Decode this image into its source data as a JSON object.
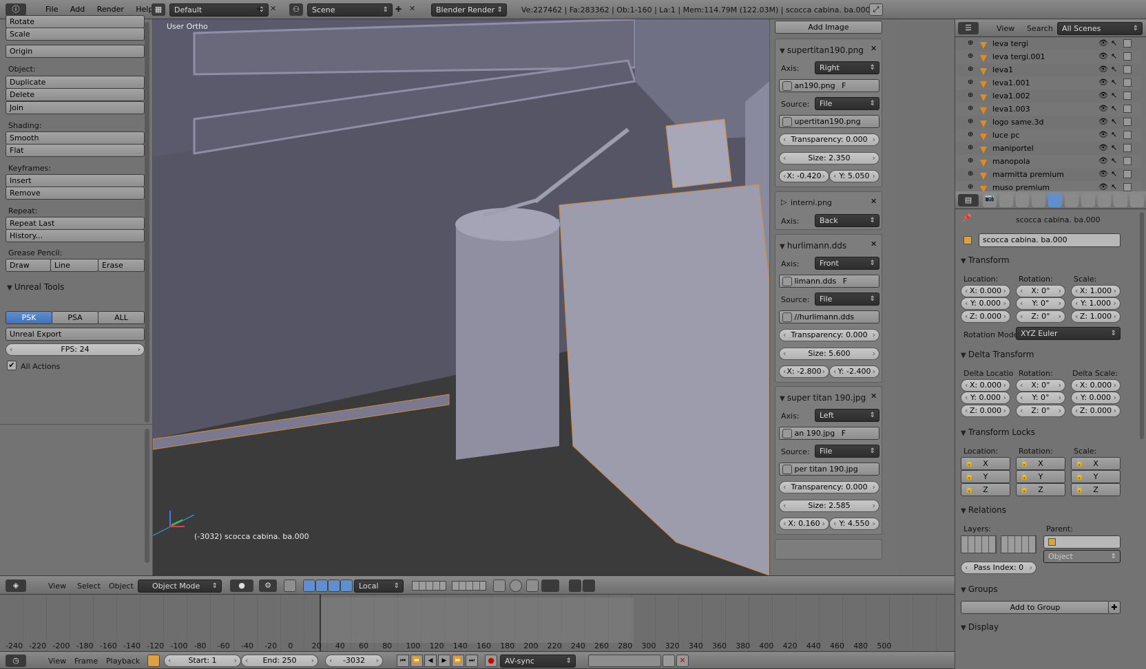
{
  "top_bar": {
    "menus": [
      "File",
      "Add",
      "Render",
      "Help"
    ],
    "layout": "Default",
    "scene": "Scene",
    "engine": "Blender Render",
    "stats": "Ve:227462 | Fa:283362 | Ob:1-160 | La:1 | Mem:114.79M (122.03M) | scocca cabina. ba.000"
  },
  "left_panel": {
    "rotate": "Rotate",
    "scale": "Scale",
    "origin": "Origin",
    "object_label": "Object:",
    "duplicate": "Duplicate",
    "delete": "Delete",
    "join": "Join",
    "shading_label": "Shading:",
    "smooth": "Smooth",
    "flat": "Flat",
    "keyframes_label": "Keyframes:",
    "insert": "Insert",
    "remove": "Remove",
    "repeat_label": "Repeat:",
    "repeat_last": "Repeat Last",
    "history": "History...",
    "grease_label": "Grease Pencil:",
    "draw": "Draw",
    "line": "Line",
    "erase": "Erase",
    "unreal_title": "Unreal Tools",
    "psk": "PSK",
    "psa": "PSA",
    "all": "ALL",
    "unreal_export": "Unreal Export",
    "fps": "FPS: 24",
    "all_actions": "All Actions"
  },
  "viewport": {
    "view_name": "User Ortho",
    "object_info": "(-3032) scocca cabina. ba.000"
  },
  "bg_panel": {
    "add_image": "Add Image",
    "images": [
      {
        "name": "supertitan190.png",
        "expanded": true,
        "axis": "Right",
        "file": "an190.png",
        "source": "File",
        "path": "upertitan190.png",
        "transparency": "Transparency: 0.000",
        "size": "Size: 2.350",
        "x": "X: -0.420",
        "y": "Y: 5.050"
      },
      {
        "name": "interni.png",
        "expanded": false,
        "axis": "Back"
      },
      {
        "name": "hurlimann.dds",
        "expanded": true,
        "axis": "Front",
        "file": "limann.dds",
        "source": "File",
        "path": "//hurlimann.dds",
        "transparency": "Transparency: 0.000",
        "size": "Size: 5.600",
        "x": "X: -2.800",
        "y": "Y: -2.400"
      },
      {
        "name": "super titan 190.jpg",
        "expanded": true,
        "axis": "Left",
        "file": "an 190.jpg",
        "source": "File",
        "path": "per titan 190.jpg",
        "transparency": "Transparency: 0.000",
        "size": "Size: 2.585",
        "x": "X: 0.160",
        "y": "Y: 4.550"
      }
    ],
    "axis_label": "Axis:",
    "source_label": "Source:",
    "f": "F"
  },
  "outliner": {
    "view": "View",
    "search": "Search",
    "scenes": "All Scenes",
    "items": [
      "leva tergi",
      "leva tergi.001",
      "leva1",
      "leva1.001",
      "leva1.002",
      "leva1.003",
      "logo same.3d",
      "luce pc",
      "maniportel",
      "manopola",
      "marmitta premium",
      "muso premium"
    ]
  },
  "properties": {
    "object_name": "scocca cabina. ba.000",
    "breadcrumb": "scocca cabina. ba.000",
    "transform": "Transform",
    "location": "Location:",
    "rotation": "Rotation:",
    "scale": "Scale:",
    "loc": [
      "X: 0.000",
      "Y: 0.000",
      "Z: 0.000"
    ],
    "rot": [
      "X: 0°",
      "Y: 0°",
      "Z: 0°"
    ],
    "scl": [
      "X: 1.000",
      "Y: 1.000",
      "Z: 1.000"
    ],
    "rotation_mode_label": "Rotation Mode",
    "rotation_mode": "XYZ Euler",
    "delta_transform": "Delta Transform",
    "delta_location": "Delta Locatio",
    "delta_rotation": "Rotation:",
    "delta_scale": "Delta Scale:",
    "dloc": [
      "X: 0.000",
      "Y: 0.000",
      "Z: 0.000"
    ],
    "drot": [
      "X: 0°",
      "Y: 0°",
      "Z: 0°"
    ],
    "dscl": [
      "X: 0.000",
      "Y: 0.000",
      "Z: 0.000"
    ],
    "transform_locks": "Transform Locks",
    "lock_loc": "Location:",
    "lock_rot": "Rotation:",
    "lock_scale": "Scale:",
    "axes": [
      "X",
      "Y",
      "Z"
    ],
    "relations": "Relations",
    "layers": "Layers:",
    "parent": "Parent:",
    "parent_type": "Object",
    "pass_index": "Pass Index: 0",
    "groups": "Groups",
    "add_to_group": "Add to Group",
    "display": "Display"
  },
  "view3d_header": {
    "view": "View",
    "select": "Select",
    "object": "Object",
    "mode": "Object Mode",
    "orientation": "Local"
  },
  "timeline": {
    "ticks": [
      "-240",
      "-220",
      "-200",
      "-180",
      "-160",
      "-140",
      "-120",
      "-100",
      "-80",
      "-60",
      "-40",
      "-20",
      "0",
      "20",
      "40",
      "60",
      "80",
      "100",
      "120",
      "140",
      "160",
      "180",
      "200",
      "220",
      "240",
      "260",
      "280",
      "300",
      "320",
      "340",
      "360",
      "380",
      "400",
      "420",
      "440",
      "460",
      "480",
      "500"
    ],
    "view": "View",
    "frame": "Frame",
    "playback": "Playback",
    "start": "Start: 1",
    "end": "End: 250",
    "current": "-3032",
    "sync": "AV-sync"
  }
}
